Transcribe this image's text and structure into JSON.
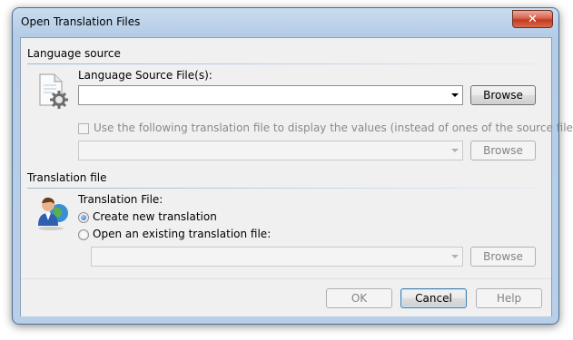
{
  "window": {
    "title": "Open Translation Files",
    "close_glyph": "✕"
  },
  "language_source": {
    "section_title": "Language source",
    "source_files_label": "Language Source File(s):",
    "source_files_value": "",
    "browse_label": "Browse",
    "use_translation_checkbox_label": "Use the following translation file to display the values (instead of ones of the source file):",
    "use_translation_checked": false,
    "translation_display_value": "",
    "browse_disabled_label": "Browse"
  },
  "translation_file": {
    "section_title": "Translation file",
    "file_label": "Translation File:",
    "options": [
      {
        "label": "Create new translation",
        "selected": true
      },
      {
        "label": "Open an existing translation file:",
        "selected": false
      }
    ],
    "existing_file_value": "",
    "browse_label": "Browse"
  },
  "footer": {
    "ok_label": "OK",
    "cancel_label": "Cancel",
    "help_label": "Help"
  }
}
